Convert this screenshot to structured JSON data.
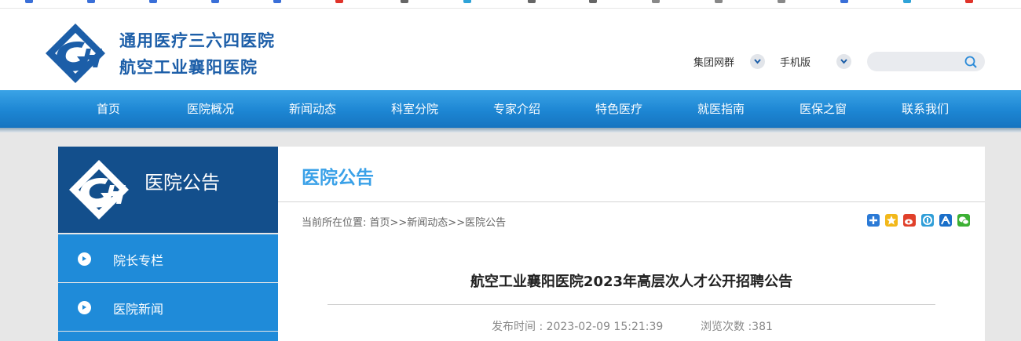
{
  "header": {
    "site_name_line1": "通用医疗三六四医院",
    "site_name_line2": "航空工业襄阳医院",
    "links": [
      {
        "label": "集团网群"
      },
      {
        "label": "手机版"
      }
    ],
    "search": {
      "placeholder": ""
    },
    "logo_icon": "gh-logo",
    "brand_color": "#1c5ea8"
  },
  "nav": {
    "items": [
      "首页",
      "医院概况",
      "新闻动态",
      "科室分院",
      "专家介绍",
      "特色医疗",
      "就医指南",
      "医保之窗",
      "联系我们"
    ],
    "color": "#1d86d3"
  },
  "sidebar": {
    "title": "医院公告",
    "items": [
      {
        "label": "院长专栏"
      },
      {
        "label": "医院新闻"
      }
    ]
  },
  "content": {
    "section_title": "医院公告",
    "breadcrumb": {
      "prefix": "当前所在位置: ",
      "path": "首页>>新闻动态>>医院公告"
    },
    "share_icons": [
      "plus-share-icon",
      "star-share-icon",
      "weibo-share-icon",
      "qzone-share-icon",
      "renren-share-icon",
      "wechat-share-icon"
    ],
    "article": {
      "title": "航空工业襄阳医院2023年高层次人才公开招聘公告",
      "publish_time": "发布时间 : 2023-02-09 15:21:39",
      "views": "浏览次数 :381"
    },
    "accent_color": "#3aa1e8"
  }
}
